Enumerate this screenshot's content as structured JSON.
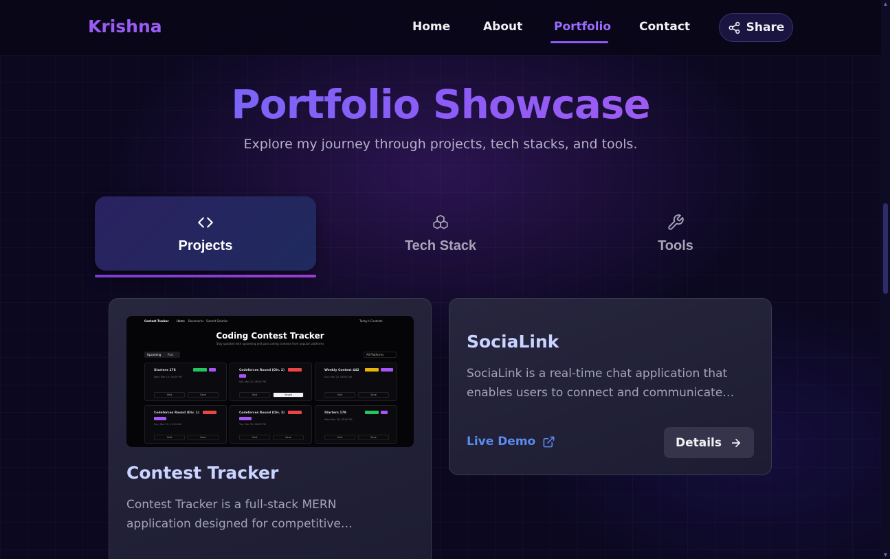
{
  "nav": {
    "logo": "Krishna",
    "links": [
      "Home",
      "About",
      "Portfolio",
      "Contact"
    ],
    "active_link": "Portfolio",
    "share_label": "Share"
  },
  "hero": {
    "title": "Portfolio Showcase",
    "subtitle": "Explore my journey through projects, tech stacks, and tools."
  },
  "tabs": [
    {
      "label": "Projects",
      "icon": "code-icon",
      "active": true
    },
    {
      "label": "Tech Stack",
      "icon": "boxes-icon",
      "active": false
    },
    {
      "label": "Tools",
      "icon": "wrench-icon",
      "active": false
    }
  ],
  "projects": [
    {
      "title": "Contest Tracker",
      "description_lines": [
        "Contest Tracker is a full-stack MERN",
        "application designed for competitive…"
      ],
      "thumbnail": {
        "app_name": "Contest Tracker",
        "nav_items": [
          "Home",
          "Bookmarks",
          "Submit Solution"
        ],
        "right_label": "Today's Contests",
        "title": "Coding Contest Tracker",
        "subtitle": "Stay updated with upcoming and past coding contests from popular platforms",
        "toggle": [
          "Upcoming",
          "Past"
        ],
        "filter": "All Platforms",
        "contests": [
          {
            "name": "Starters 178",
            "date": "Wed, Mar 19, 08:00 PM",
            "badges": [
              "#22c55e",
              "#a855f7"
            ],
            "save": "Save"
          },
          {
            "name": "Codeforces Round (Div. 2)",
            "date": "Sat, Mar 22, 08:05 PM",
            "badges": [
              "#ef4444",
              "#a855f7"
            ],
            "save": "Saved"
          },
          {
            "name": "Weekly Contest 442",
            "date": "Sun, Mar 23, 08:00 AM",
            "badges": [
              "#eab308",
              "#a855f7"
            ],
            "save": "Save"
          },
          {
            "name": "Codeforces Round (Div. 1)",
            "date": "Sun, Mar 23, 11:05 AM",
            "badges": [
              "#ef4444",
              "#a855f7"
            ],
            "save": "Save"
          },
          {
            "name": "Codeforces Round (Div. 3)",
            "date": "Tue, Mar 25, 08:05 PM",
            "badges": [
              "#ef4444",
              "#a855f7"
            ],
            "save": "Save"
          },
          {
            "name": "Starters 179",
            "date": "Wed, Mar 26, 08:00 PM",
            "badges": [
              "#22c55e",
              "#a855f7"
            ],
            "save": "Save"
          }
        ],
        "visit": "Visit"
      }
    },
    {
      "title": "SociaLink",
      "description_lines": [
        "SociaLink is a real-time chat application that",
        "enables users to connect and communicate…"
      ],
      "live_demo_label": "Live Demo",
      "details_label": "Details"
    }
  ],
  "colors": {
    "accent": "#8b5cf6",
    "link_blue": "#5a8df0",
    "card_title": "#c9d4ff"
  }
}
